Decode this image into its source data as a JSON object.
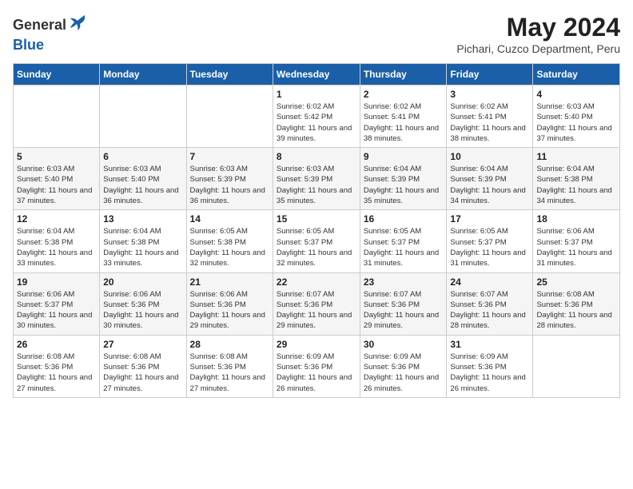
{
  "header": {
    "logo_general": "General",
    "logo_blue": "Blue",
    "month_year": "May 2024",
    "location": "Pichari, Cuzco Department, Peru"
  },
  "days_of_week": [
    "Sunday",
    "Monday",
    "Tuesday",
    "Wednesday",
    "Thursday",
    "Friday",
    "Saturday"
  ],
  "weeks": [
    [
      {
        "day": "",
        "info": ""
      },
      {
        "day": "",
        "info": ""
      },
      {
        "day": "",
        "info": ""
      },
      {
        "day": "1",
        "info": "Sunrise: 6:02 AM\nSunset: 5:42 PM\nDaylight: 11 hours and 39 minutes."
      },
      {
        "day": "2",
        "info": "Sunrise: 6:02 AM\nSunset: 5:41 PM\nDaylight: 11 hours and 38 minutes."
      },
      {
        "day": "3",
        "info": "Sunrise: 6:02 AM\nSunset: 5:41 PM\nDaylight: 11 hours and 38 minutes."
      },
      {
        "day": "4",
        "info": "Sunrise: 6:03 AM\nSunset: 5:40 PM\nDaylight: 11 hours and 37 minutes."
      }
    ],
    [
      {
        "day": "5",
        "info": "Sunrise: 6:03 AM\nSunset: 5:40 PM\nDaylight: 11 hours and 37 minutes."
      },
      {
        "day": "6",
        "info": "Sunrise: 6:03 AM\nSunset: 5:40 PM\nDaylight: 11 hours and 36 minutes."
      },
      {
        "day": "7",
        "info": "Sunrise: 6:03 AM\nSunset: 5:39 PM\nDaylight: 11 hours and 36 minutes."
      },
      {
        "day": "8",
        "info": "Sunrise: 6:03 AM\nSunset: 5:39 PM\nDaylight: 11 hours and 35 minutes."
      },
      {
        "day": "9",
        "info": "Sunrise: 6:04 AM\nSunset: 5:39 PM\nDaylight: 11 hours and 35 minutes."
      },
      {
        "day": "10",
        "info": "Sunrise: 6:04 AM\nSunset: 5:39 PM\nDaylight: 11 hours and 34 minutes."
      },
      {
        "day": "11",
        "info": "Sunrise: 6:04 AM\nSunset: 5:38 PM\nDaylight: 11 hours and 34 minutes."
      }
    ],
    [
      {
        "day": "12",
        "info": "Sunrise: 6:04 AM\nSunset: 5:38 PM\nDaylight: 11 hours and 33 minutes."
      },
      {
        "day": "13",
        "info": "Sunrise: 6:04 AM\nSunset: 5:38 PM\nDaylight: 11 hours and 33 minutes."
      },
      {
        "day": "14",
        "info": "Sunrise: 6:05 AM\nSunset: 5:38 PM\nDaylight: 11 hours and 32 minutes."
      },
      {
        "day": "15",
        "info": "Sunrise: 6:05 AM\nSunset: 5:37 PM\nDaylight: 11 hours and 32 minutes."
      },
      {
        "day": "16",
        "info": "Sunrise: 6:05 AM\nSunset: 5:37 PM\nDaylight: 11 hours and 31 minutes."
      },
      {
        "day": "17",
        "info": "Sunrise: 6:05 AM\nSunset: 5:37 PM\nDaylight: 11 hours and 31 minutes."
      },
      {
        "day": "18",
        "info": "Sunrise: 6:06 AM\nSunset: 5:37 PM\nDaylight: 11 hours and 31 minutes."
      }
    ],
    [
      {
        "day": "19",
        "info": "Sunrise: 6:06 AM\nSunset: 5:37 PM\nDaylight: 11 hours and 30 minutes."
      },
      {
        "day": "20",
        "info": "Sunrise: 6:06 AM\nSunset: 5:36 PM\nDaylight: 11 hours and 30 minutes."
      },
      {
        "day": "21",
        "info": "Sunrise: 6:06 AM\nSunset: 5:36 PM\nDaylight: 11 hours and 29 minutes."
      },
      {
        "day": "22",
        "info": "Sunrise: 6:07 AM\nSunset: 5:36 PM\nDaylight: 11 hours and 29 minutes."
      },
      {
        "day": "23",
        "info": "Sunrise: 6:07 AM\nSunset: 5:36 PM\nDaylight: 11 hours and 29 minutes."
      },
      {
        "day": "24",
        "info": "Sunrise: 6:07 AM\nSunset: 5:36 PM\nDaylight: 11 hours and 28 minutes."
      },
      {
        "day": "25",
        "info": "Sunrise: 6:08 AM\nSunset: 5:36 PM\nDaylight: 11 hours and 28 minutes."
      }
    ],
    [
      {
        "day": "26",
        "info": "Sunrise: 6:08 AM\nSunset: 5:36 PM\nDaylight: 11 hours and 27 minutes."
      },
      {
        "day": "27",
        "info": "Sunrise: 6:08 AM\nSunset: 5:36 PM\nDaylight: 11 hours and 27 minutes."
      },
      {
        "day": "28",
        "info": "Sunrise: 6:08 AM\nSunset: 5:36 PM\nDaylight: 11 hours and 27 minutes."
      },
      {
        "day": "29",
        "info": "Sunrise: 6:09 AM\nSunset: 5:36 PM\nDaylight: 11 hours and 26 minutes."
      },
      {
        "day": "30",
        "info": "Sunrise: 6:09 AM\nSunset: 5:36 PM\nDaylight: 11 hours and 26 minutes."
      },
      {
        "day": "31",
        "info": "Sunrise: 6:09 AM\nSunset: 5:36 PM\nDaylight: 11 hours and 26 minutes."
      },
      {
        "day": "",
        "info": ""
      }
    ]
  ]
}
